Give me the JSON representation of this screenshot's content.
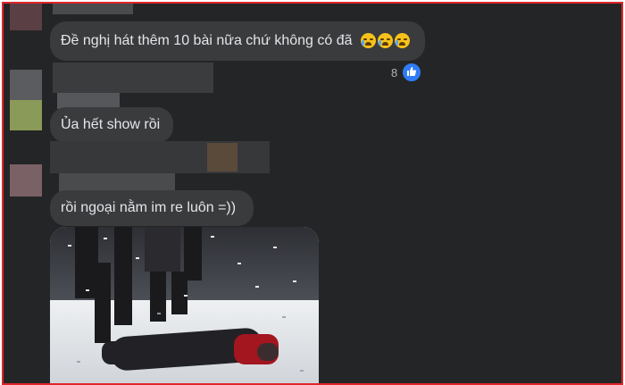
{
  "comments": [
    {
      "text": "Đề nghị hát thêm 10 bài nữa chứ không có đã",
      "emoji": [
        "loudly-crying-face",
        "loudly-crying-face",
        "loudly-crying-face"
      ]
    },
    {
      "text": "Ủa hết show rồi"
    },
    {
      "text": "rồi ngoại nằm im re luôn =))"
    }
  ],
  "reaction": {
    "count": "8",
    "icon": "like-icon",
    "color": "#2f7cf6"
  },
  "colors": {
    "background": "#242526",
    "bubble": "#3a3b3c",
    "text": "#e4e6eb",
    "frame": "#e0262a"
  },
  "photo": {
    "icon": "concert-stage-photo"
  }
}
